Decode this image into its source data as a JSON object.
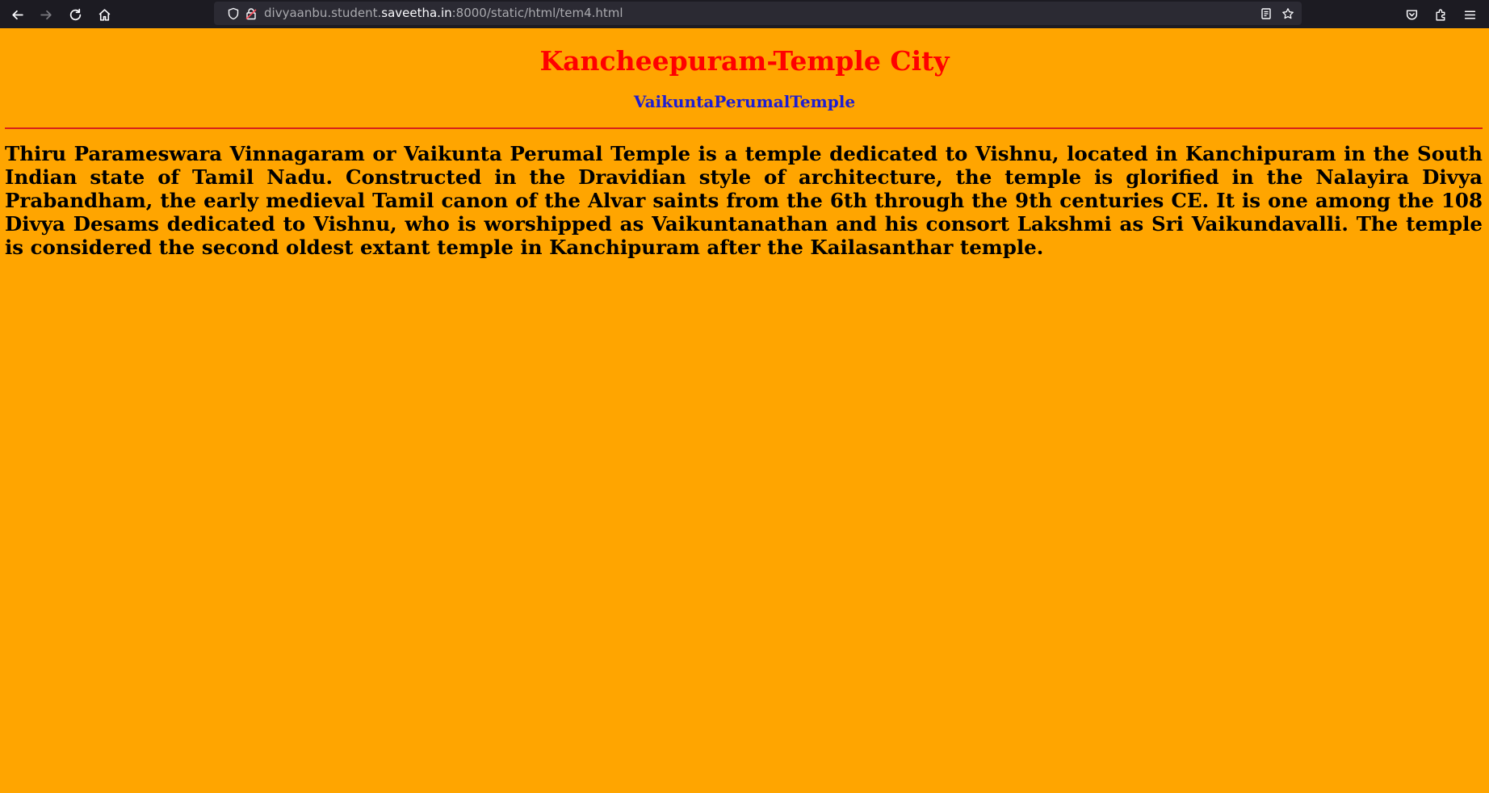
{
  "browser": {
    "url_prefix": "divyaanbu.student.",
    "url_domain": "saveetha.in",
    "url_suffix": ":8000/static/html/tem4.html",
    "icons": {
      "back": "arrow-left-icon",
      "forward": "arrow-right-icon",
      "reload": "reload-icon",
      "home": "home-icon",
      "shield": "shield-icon",
      "lock": "lock-icon",
      "reader": "reader-view-icon",
      "bookmark": "star-icon",
      "pocket": "pocket-icon",
      "extensions": "puzzle-icon",
      "menu": "hamburger-menu-icon"
    }
  },
  "page": {
    "title": "Kancheepuram-Temple City",
    "subtitle": "VaikuntaPerumalTemple",
    "paragraph": "Thiru Parameswara Vinnagaram or Vaikunta Perumal Temple is a temple dedicated to Vishnu, located in Kanchipuram in the South Indian state of Tamil Nadu. Constructed in the Dravidian style of architecture, the temple is glorified in the Nalayira Divya Prabandham, the early medieval Tamil canon of the Alvar saints from the 6th through the 9th centuries CE. It is one among the 108 Divya Desams dedicated to Vishnu, who is worshipped as Vaikuntanathan and his consort Lakshmi as Sri Vaikundavalli. The temple is considered the second oldest extant temple in Kanchipuram after the Kailasanthar temple."
  },
  "colors": {
    "background": "#ffa500",
    "title": "#ff0000",
    "subtitle": "#1e1ed2",
    "rule": "#d8221a",
    "text": "#000000"
  }
}
